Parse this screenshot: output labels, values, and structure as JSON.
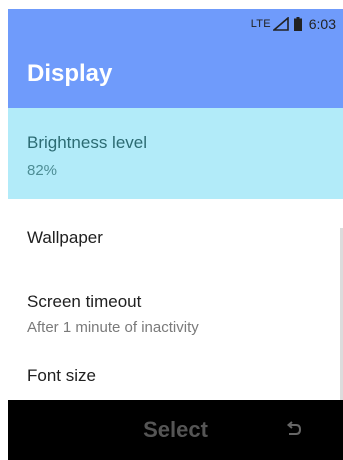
{
  "status_bar": {
    "network": "LTE",
    "time": "6:03",
    "signal_icon": "signal-icon",
    "battery_icon": "battery-icon"
  },
  "header": {
    "title": "Display"
  },
  "settings": {
    "items": [
      {
        "label": "Brightness level",
        "value": "82%",
        "selected": true
      },
      {
        "label": "Wallpaper"
      },
      {
        "label": "Screen timeout",
        "value": "After 1 minute of inactivity"
      },
      {
        "label": "Font size"
      }
    ]
  },
  "softkeys": {
    "center_label": "Select",
    "right_icon": "back-icon"
  },
  "colors": {
    "header_bg": "#6f9bfb",
    "selected_bg": "#b2ebf9",
    "softkey_bg": "#000000"
  }
}
